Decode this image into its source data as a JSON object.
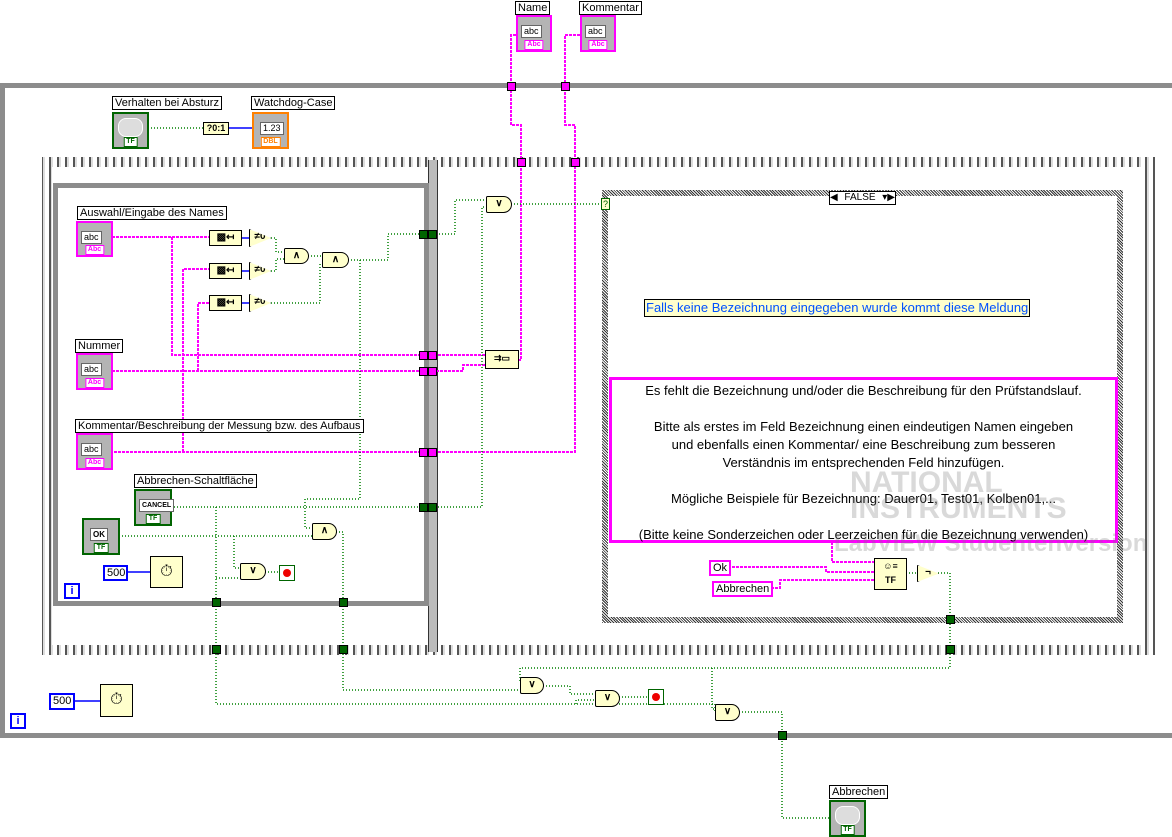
{
  "controls": {
    "name": {
      "label": "Name",
      "value": "abc",
      "type": "Abc"
    },
    "kommentar": {
      "label": "Kommentar",
      "value": "abc",
      "type": "Abc"
    },
    "verhalten": {
      "label": "Verhalten bei Absturz",
      "type": "TF"
    },
    "watchdog": {
      "label": "Watchdog-Case",
      "value": "1.23",
      "type": "DBL"
    },
    "auswahl": {
      "label": "Auswahl/Eingabe des Names",
      "value": "abc",
      "type": "Abc"
    },
    "nummer": {
      "label": "Nummer",
      "value": "abc",
      "type": "Abc"
    },
    "beschreibung": {
      "label": "Kommentar/Beschreibung der Messung bzw. des Aufbaus",
      "value": "abc",
      "type": "Abc"
    },
    "abbrechen_button": {
      "label": "Abbrechen-Schaltfläche",
      "value": "CANCEL",
      "type": "TF"
    },
    "ok_button": {
      "value": "OK",
      "type": "TF"
    },
    "abbrechen_indicator": {
      "label": "Abbrechen",
      "type": "TF"
    }
  },
  "nodes": {
    "bool_to_num": "?0:1",
    "not_zero": "≠0",
    "and": "∧",
    "or": "∨",
    "not": "¬",
    "iteration": "i"
  },
  "constants": {
    "wait_inner": "500",
    "wait_outer": "500",
    "ok": "Ok",
    "abbrechen": "Abbrechen"
  },
  "case_structure": {
    "selector": "FALSE",
    "comment": "Falls keine Bezeichnung eingegeben wurde kommt diese Meldung",
    "message": "Es fehlt die Bezeichnung und/oder die Beschreibung für den Prüfstandslauf.\n\nBitte als erstes im Feld Bezeichnung einen eindeutigen Namen eingeben\nund ebenfalls einen Kommentar/ eine Beschreibung zum besseren\nVerständnis im entsprechenden Feld hinzufügen.\n\nMögliche Beispiele für Bezeichnung: Dauer01, Test01, Kolben01,...\n\n(Bitte keine Sonderzeichen oder Leerzeichen für die Bezeichnung verwenden)"
  },
  "watermark": {
    "line1": "NATIONAL",
    "line2": "INSTRUMENTS",
    "line3": "LabVIEW  Studentenversion"
  },
  "colors": {
    "string_wire": "#ff00ff",
    "bool_wire": "#006400",
    "numeric_wire": "#0000ff",
    "loop_border": "#8c8c8c"
  }
}
